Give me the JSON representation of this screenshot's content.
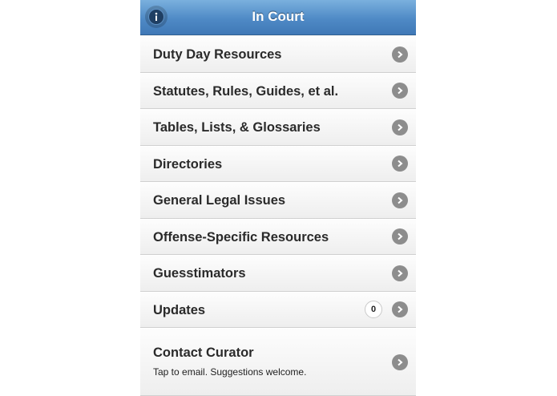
{
  "header": {
    "title": "In Court",
    "info_icon": "info-icon"
  },
  "items": [
    {
      "label": "Duty Day Resources",
      "icon": "chevron-right-icon"
    },
    {
      "label": "Statutes, Rules, Guides, et al.",
      "icon": "chevron-right-icon"
    },
    {
      "label": "Tables, Lists, & Glossaries",
      "icon": "chevron-right-icon"
    },
    {
      "label": "Directories",
      "icon": "chevron-right-icon"
    },
    {
      "label": "General Legal Issues",
      "icon": "chevron-right-icon"
    },
    {
      "label": "Offense-Specific Resources",
      "icon": "chevron-right-icon"
    },
    {
      "label": "Guesstimators",
      "icon": "chevron-right-icon"
    },
    {
      "label": "Updates",
      "count": "0",
      "icon": "chevron-right-icon"
    },
    {
      "label": "Contact Curator",
      "subtitle": "Tap to email. Suggestions welcome.",
      "icon": "chevron-right-icon"
    }
  ],
  "colors": {
    "header": "#4f8ac6",
    "arrow": "#8d8d8d"
  }
}
